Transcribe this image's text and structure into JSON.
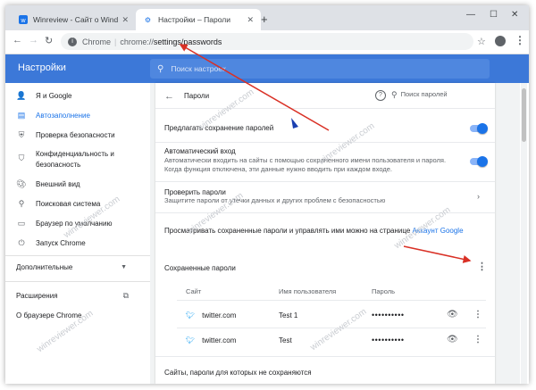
{
  "tabs": [
    {
      "title": "Winreview - Сайт о Windows",
      "favicon": "winreview-favicon"
    },
    {
      "title": "Настройки – Пароли",
      "favicon": "settings-gear-icon"
    }
  ],
  "address": {
    "scheme": "Chrome",
    "separator": "|",
    "path_prefix": "chrome://",
    "path": "settings/passwords"
  },
  "header": {
    "title": "Настройки",
    "search_placeholder": "Поиск настроек"
  },
  "sidebar": {
    "items": [
      {
        "label": "Я и Google",
        "icon": "person-icon"
      },
      {
        "label": "Автозаполнение",
        "icon": "autofill-icon",
        "selected": true
      },
      {
        "label": "Проверка безопасности",
        "icon": "shield-check-icon"
      },
      {
        "label": "Конфиденциальность и",
        "label2": "безопасность",
        "icon": "shield-icon"
      },
      {
        "label": "Внешний вид",
        "icon": "palette-icon"
      },
      {
        "label": "Поисковая система",
        "icon": "search-icon"
      },
      {
        "label": "Браузер по умолчанию",
        "icon": "browser-icon"
      },
      {
        "label": "Запуск Chrome",
        "icon": "power-icon"
      }
    ],
    "advanced": "Дополнительные",
    "extensions": "Расширения",
    "about": "О браузере Chrome"
  },
  "passwords": {
    "title": "Пароли",
    "search_placeholder": "Поиск паролей",
    "offer_save": "Предлагать сохранение паролей",
    "autosignin_title": "Автоматический вход",
    "autosignin_desc1": "Автоматически входить на сайты с помощью сохраненного имени пользователя и пароля.",
    "autosignin_desc2": "Когда функция отключена, эти данные нужно вводить при каждом входе.",
    "check_title": "Проверить пароли",
    "check_desc": "Защитите пароли от утечки данных и других проблем с безопасностью",
    "manage_text": "Просматривать сохраненные пароли и управлять ими можно на странице ",
    "manage_link": "Аккаунт Google",
    "saved_title": "Сохраненные пароли",
    "columns": {
      "site": "Сайт",
      "user": "Имя пользователя",
      "password": "Пароль"
    },
    "rows": [
      {
        "site": "twitter.com",
        "user": "Test 1",
        "password": "••••••••••"
      },
      {
        "site": "twitter.com",
        "user": "Test",
        "password": "••••••••••"
      }
    ],
    "never_saved": "Сайты, пароли для которых не сохраняются"
  },
  "watermark": "winreviewer.com",
  "colors": {
    "accent": "#1a73e8",
    "header": "#3c78d8",
    "arrow": "#d93025"
  }
}
